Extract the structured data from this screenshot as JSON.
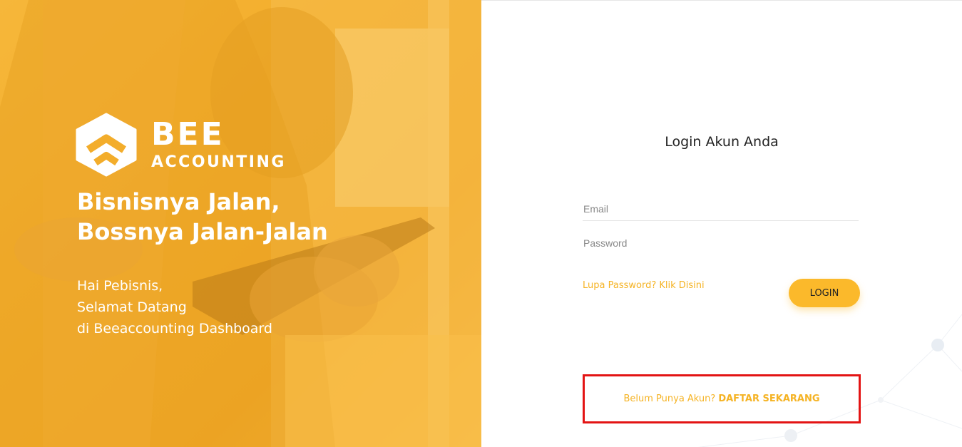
{
  "hero": {
    "logo": {
      "name_line1": "BEE",
      "name_line2": "ACCOUNTING"
    },
    "tagline_line1": "Bisnisnya Jalan,",
    "tagline_line2": "Bossnya Jalan-Jalan",
    "greeting_line1": "Hai Pebisnis,",
    "greeting_line2": "Selamat Datang",
    "greeting_line3": "di Beeaccounting Dashboard",
    "background_color": "#f3ad2b"
  },
  "login": {
    "title": "Login Akun Anda",
    "email_placeholder": "Email",
    "password_placeholder": "Password",
    "forgot_link": "Lupa Password? Klik Disini",
    "login_button": "LOGIN",
    "register_prompt": "Belum Punya Akun?",
    "register_cta": "DAFTAR SEKARANG",
    "accent_color": "#fbb92b",
    "highlight_color": "#e31414"
  }
}
